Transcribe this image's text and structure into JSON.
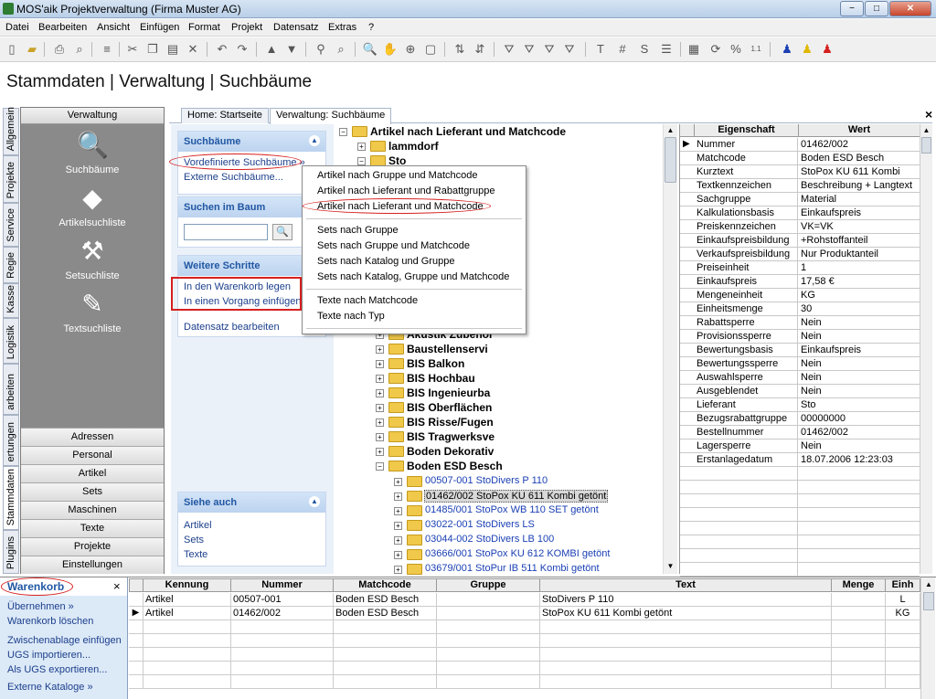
{
  "window": {
    "title": "MOS'aik Projektverwaltung (Firma Muster AG)",
    "min": "−",
    "max": "□",
    "close": "✕"
  },
  "menu": [
    "Datei",
    "Bearbeiten",
    "Ansicht",
    "Einfügen",
    "Format",
    "Projekt",
    "Datensatz",
    "Extras",
    "?"
  ],
  "toolbar": {
    "hash": "#",
    "s": "S",
    "percent": "%",
    "t": "T"
  },
  "heading": "Stammdaten | Verwaltung | Suchbäume",
  "left_tabs": [
    "Allgemein",
    "Projekte",
    "Service",
    "Regie",
    "Kasse",
    "Logistik",
    "Auswertungen",
    "Stammdaten",
    "Plugins"
  ],
  "left_tabs_clip": [
    "Allgemein",
    "Projekte",
    "Service",
    "Regie",
    "Kasse",
    "Logistik",
    "arbeiten",
    "ertungen",
    "Stammdaten",
    "Plugins"
  ],
  "nav": {
    "header": "Verwaltung",
    "icons": [
      "Suchbäume",
      "Artikelsuchliste",
      "Setsuchliste",
      "Textsuchliste"
    ],
    "buttons": [
      "Adressen",
      "Personal",
      "Artikel",
      "Sets",
      "Maschinen",
      "Texte",
      "Projekte",
      "Einstellungen"
    ]
  },
  "tabs": [
    "Home: Startseite",
    "Verwaltung: Suchbäume"
  ],
  "tabs_close": "×",
  "taskpane": {
    "suchbaeume": {
      "title": "Suchbäume",
      "links": [
        "Vordefinierte Suchbäume »",
        "Externe Suchbäume..."
      ]
    },
    "suchen": {
      "title": "Suchen im Baum",
      "search_value": "",
      "search_btn": "🔍"
    },
    "weitere": {
      "title": "Weitere Schritte",
      "links": [
        "In den Warenkorb legen",
        "In einen Vorgang einfügen",
        "Datensatz bearbeiten"
      ]
    },
    "siehe": {
      "title": "Siehe auch",
      "links": [
        "Artikel",
        "Sets",
        "Texte"
      ]
    }
  },
  "tree": {
    "root": "Artikel nach Lieferant und Matchcode",
    "top_nodes": [
      "lammdorf",
      "Sto"
    ],
    "groups": [
      "Akustik Zubehör",
      "Baustellenservi",
      "BIS Balkon",
      "BIS Hochbau",
      "BIS Ingenieurba",
      "BIS Oberflächen",
      "BIS Risse/Fugen",
      "BIS Tragwerksve",
      "Boden Dekorativ",
      "Boden ESD Besch"
    ],
    "items": [
      "00507-001 StoDivers P 110",
      "01462/002 StoPox KU 611 Kombi getönt",
      "01485/001 StoPox WB 110 SET getönt",
      "03022-001 StoDivers LS",
      "03044-002 StoDivers LB 100",
      "03666/001 StoPox KU 612 KOMBI getönt",
      "03679/001 StoPur IB 511 Kombi getönt"
    ],
    "selected_item": "01462/002 StoPox KU 611 Kombi getönt"
  },
  "popup": {
    "group1": [
      "Artikel nach Gruppe und Matchcode",
      "Artikel nach Lieferant und Rabattgruppe",
      "Artikel nach Lieferant und Matchcode"
    ],
    "group2": [
      "Sets nach Gruppe",
      "Sets nach Gruppe und Matchcode",
      "Sets nach Katalog und Gruppe",
      "Sets nach Katalog, Gruppe und Matchcode"
    ],
    "group3": [
      "Texte nach Matchcode",
      "Texte nach Typ"
    ]
  },
  "properties": {
    "col_key": "Eigenschaft",
    "col_val": "Wert",
    "rows": [
      [
        "Nummer",
        "01462/002"
      ],
      [
        "Matchcode",
        "Boden ESD Besch"
      ],
      [
        "Kurztext",
        "StoPox KU 611 Kombi"
      ],
      [
        "Textkennzeichen",
        "Beschreibung + Langtext"
      ],
      [
        "Sachgruppe",
        "Material"
      ],
      [
        "Kalkulationsbasis",
        "Einkaufspreis"
      ],
      [
        "Preiskennzeichen",
        "VK=VK"
      ],
      [
        "Einkaufspreisbildung",
        "+Rohstoffanteil"
      ],
      [
        "Verkaufspreisbildung",
        "Nur Produktanteil"
      ],
      [
        "Preiseinheit",
        "1"
      ],
      [
        "Einkaufspreis",
        "17,58 €"
      ],
      [
        "Mengeneinheit",
        "KG"
      ],
      [
        "Einheitsmenge",
        "30"
      ],
      [
        "Rabattsperre",
        "Nein"
      ],
      [
        "Provisionssperre",
        "Nein"
      ],
      [
        "Bewertungsbasis",
        "Einkaufspreis"
      ],
      [
        "Bewertungssperre",
        "Nein"
      ],
      [
        "Auswahlsperre",
        "Nein"
      ],
      [
        "Ausgeblendet",
        "Nein"
      ],
      [
        "Lieferant",
        "Sto"
      ],
      [
        "Bezugsrabattgruppe",
        "00000000"
      ],
      [
        "Bestellnummer",
        "01462/002"
      ],
      [
        "Lagersperre",
        "Nein"
      ],
      [
        "Erstanlagedatum",
        "18.07.2006 12:23:03"
      ]
    ]
  },
  "warenkorb": {
    "title": "Warenkorb",
    "close": "×",
    "links1": [
      "Übernehmen »",
      "Warenkorb löschen"
    ],
    "links2": [
      "Zwischenablage einfügen",
      "UGS importieren...",
      "Als UGS exportieren..."
    ],
    "links3": [
      "Externe Kataloge »"
    ]
  },
  "cart_grid": {
    "headers": [
      "Kennung",
      "Nummer",
      "Matchcode",
      "Gruppe",
      "Text",
      "Menge",
      "Einh"
    ],
    "rows": [
      [
        "Artikel",
        "00507-001",
        "Boden ESD Besch",
        "",
        "StoDivers P 110",
        "",
        "L"
      ],
      [
        "Artikel",
        "01462/002",
        "Boden ESD Besch",
        "",
        "StoPox KU 611 Kombi getönt",
        "",
        "KG"
      ]
    ]
  },
  "colors": {
    "accent": "#2157a3",
    "highlight": "#d62020",
    "folder": "#f0c84a"
  }
}
